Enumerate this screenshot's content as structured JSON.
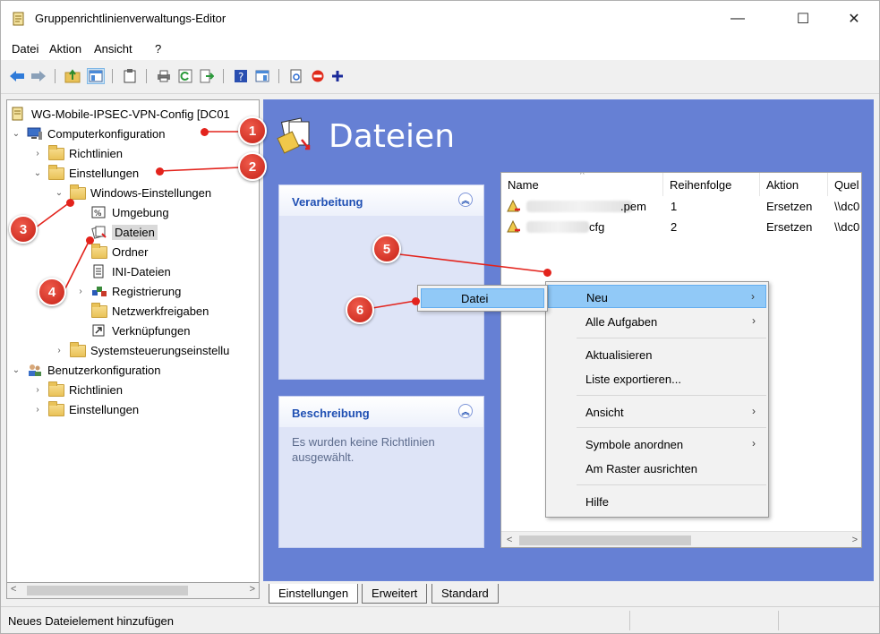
{
  "window": {
    "title": "Gruppenrichtlinienverwaltungs-Editor",
    "minimize": "—",
    "maximize": "☐",
    "close": "✕"
  },
  "menu": {
    "items": [
      "Datei",
      "Aktion",
      "Ansicht",
      "?"
    ]
  },
  "tree": {
    "root": "WG-Mobile-IPSEC-VPN-Config [DC01",
    "nodes": [
      "Computerkonfiguration",
      "Richtlinien",
      "Einstellungen",
      "Windows-Einstellungen",
      "Umgebung",
      "Dateien",
      "Ordner",
      "INI-Dateien",
      "Registrierung",
      "Netzwerkfreigaben",
      "Verknüpfungen",
      "Systemsteuerungseinstellu",
      "Benutzerkonfiguration",
      "Richtlinien",
      "Einstellungen"
    ]
  },
  "main": {
    "title": "Dateien",
    "panel_processing": {
      "title": "Verarbeitung"
    },
    "panel_description": {
      "title": "Beschreibung",
      "text": "Es wurden keine Richtlinien ausgewählt."
    },
    "list": {
      "columns": [
        "Name",
        "Reihenfolge",
        "Aktion",
        "Quel"
      ],
      "rows": [
        {
          "name": ".pem",
          "order": "1",
          "action": "Ersetzen",
          "source": "\\\\dc0"
        },
        {
          "name": "cfg",
          "order": "2",
          "action": "Ersetzen",
          "source": "\\\\dc0"
        }
      ]
    }
  },
  "context_menu": {
    "items": [
      {
        "label": "Neu",
        "arrow": "›"
      },
      {
        "label": "Alle Aufgaben",
        "arrow": "›"
      },
      {
        "label": "Aktualisieren",
        "arrow": ""
      },
      {
        "label": "Liste exportieren...",
        "arrow": ""
      },
      {
        "label": "Ansicht",
        "arrow": "›"
      },
      {
        "label": "Symbole anordnen",
        "arrow": "›"
      },
      {
        "label": "Am Raster ausrichten",
        "arrow": ""
      },
      {
        "label": "Hilfe",
        "arrow": ""
      }
    ],
    "submenu_item": "Datei"
  },
  "tabs": [
    "Einstellungen",
    "Erweitert",
    "Standard"
  ],
  "status": {
    "text": "Neues Dateielement hinzufügen"
  },
  "annotations": [
    "1",
    "2",
    "3",
    "4",
    "5",
    "6"
  ],
  "colors": {
    "main_bg": "#6680d4",
    "badge": "#d22a1e",
    "highlight": "#91c9f7"
  }
}
